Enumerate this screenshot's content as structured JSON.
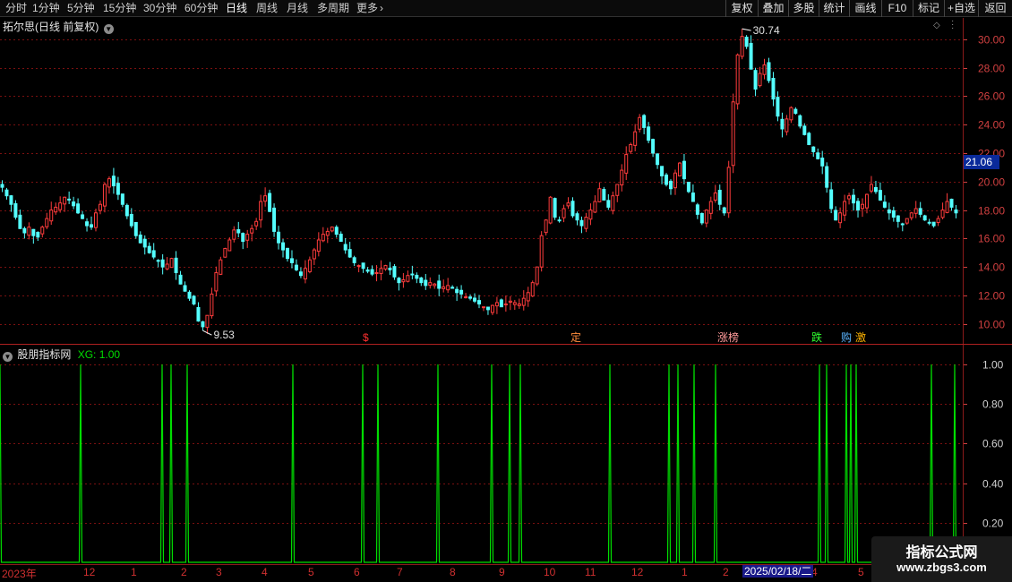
{
  "toolbar": {
    "periods": [
      "分时",
      "1分钟",
      "5分钟",
      "15分钟",
      "30分钟",
      "60分钟",
      "日线",
      "周线",
      "月线",
      "多周期",
      "更多"
    ],
    "active_period": "日线",
    "right_buttons": [
      "复权",
      "叠加",
      "多股",
      "统计",
      "画线",
      "F10",
      "标记",
      "+自选",
      "返回"
    ]
  },
  "main_title": "拓尔思(日线 前复权)",
  "current_price_tag": "21.06",
  "indicator": {
    "name": "股朋指标网",
    "label": "XG:",
    "value": "1.00"
  },
  "events": [
    {
      "text": "$",
      "color": "#ff3030"
    },
    {
      "text": "定",
      "color": "#ff8c3c"
    },
    {
      "text": "涨榜",
      "color": "#ff9a9a"
    },
    {
      "text": "跌",
      "color": "#30ff30"
    },
    {
      "text": "购",
      "color": "#5ab4ff"
    },
    {
      "text": "激",
      "color": "#ffb400"
    }
  ],
  "date_axis": [
    "2023年",
    "12",
    "1",
    "2",
    "3",
    "4",
    "5",
    "6",
    "7",
    "8",
    "9",
    "10",
    "11",
    "12",
    "1",
    "2",
    "4",
    "5"
  ],
  "date_cursor": "2025/02/18/二",
  "watermark": {
    "title": "指标公式网",
    "url": "www.zbgs3.com"
  },
  "colors": {
    "up": "#ff3c3c",
    "down": "#54ffff",
    "indicator_line": "#00dd00",
    "grid": "#7a1010",
    "axis": "#d04040"
  },
  "chart_data": [
    {
      "type": "candlestick",
      "title": "拓尔思(日线 前复权)",
      "y_ticks": [
        10.0,
        12.0,
        14.0,
        16.0,
        18.0,
        20.0,
        22.0,
        24.0,
        26.0,
        28.0,
        30.0
      ],
      "ylim": [
        8.6,
        31.5
      ],
      "annotations": [
        {
          "label": "30.74",
          "value": 30.74
        },
        {
          "label": "9.53",
          "value": 9.53
        }
      ],
      "last_price": 21.06,
      "close_series": [
        19.6,
        19.0,
        18.4,
        17.5,
        16.7,
        16.4,
        16.8,
        16.2,
        16.1,
        16.8,
        17.4,
        18.0,
        18.2,
        18.5,
        18.9,
        18.7,
        18.3,
        17.8,
        17.4,
        16.9,
        16.8,
        17.8,
        18.4,
        19.8,
        20.2,
        19.7,
        19.1,
        18.4,
        17.6,
        16.9,
        16.2,
        15.7,
        15.4,
        15.0,
        14.7,
        14.4,
        14.0,
        14.2,
        14.6,
        13.6,
        12.8,
        12.3,
        11.8,
        11.4,
        10.2,
        9.8,
        10.6,
        12.1,
        13.6,
        14.5,
        15.3,
        15.9,
        16.6,
        16.4,
        15.8,
        16.3,
        16.7,
        17.2,
        18.6,
        19.0,
        17.9,
        16.5,
        15.7,
        15.2,
        14.6,
        14.3,
        13.8,
        13.4,
        13.9,
        14.5,
        15.2,
        15.9,
        16.3,
        16.5,
        16.8,
        16.3,
        15.8,
        15.2,
        14.7,
        14.3,
        14.1,
        13.9,
        13.7,
        13.5,
        13.6,
        13.9,
        14.1,
        13.8,
        13.3,
        12.9,
        13.1,
        13.4,
        13.5,
        13.2,
        12.9,
        12.7,
        12.9,
        12.8,
        12.5,
        12.6,
        12.7,
        12.5,
        12.2,
        12.1,
        11.9,
        11.8,
        11.6,
        11.4,
        11.2,
        11.0,
        11.3,
        11.5,
        11.2,
        11.4,
        11.6,
        11.5,
        11.4,
        11.8,
        12.2,
        12.9,
        14.0,
        16.2,
        17.3,
        18.9,
        17.5,
        17.3,
        18.1,
        18.5,
        17.6,
        17.3,
        16.9,
        17.5,
        18.0,
        18.6,
        19.5,
        18.7,
        18.2,
        19.0,
        19.8,
        20.8,
        21.9,
        22.6,
        23.5,
        24.5,
        23.8,
        22.9,
        22.0,
        21.2,
        20.4,
        19.8,
        19.5,
        20.6,
        21.3,
        20.2,
        19.3,
        18.6,
        17.7,
        17.1,
        18.0,
        18.6,
        19.2,
        18.4,
        17.8,
        21.0,
        25.6,
        28.9,
        30.2,
        29.5,
        27.9,
        26.5,
        27.6,
        28.2,
        27.1,
        25.8,
        24.6,
        23.7,
        24.4,
        25.2,
        24.8,
        23.9,
        23.3,
        22.6,
        22.1,
        21.6,
        21.1,
        19.6,
        18.1,
        17.3,
        17.8,
        18.6,
        19.0,
        18.5,
        18.0,
        18.4,
        19.1,
        19.8,
        19.3,
        18.7,
        18.2,
        17.8,
        17.5,
        17.2,
        17.0,
        17.4,
        17.8,
        18.1,
        17.7,
        17.3,
        17.1,
        16.9,
        17.4,
        18.0,
        18.6,
        18.2,
        17.8
      ]
    },
    {
      "type": "line",
      "name": "XG",
      "y_ticks": [
        0.2,
        0.4,
        0.6,
        0.8,
        1.0
      ],
      "ylim": [
        0,
        1.0
      ],
      "pulse_x_positions": [
        0,
        90,
        181,
        191,
        209,
        327,
        405,
        422,
        489,
        549,
        569,
        581,
        681,
        747,
        757,
        775,
        799,
        915,
        923,
        945,
        950,
        956,
        1040,
        1066
      ],
      "signal_value": 1.0,
      "x_span": 1075
    }
  ]
}
